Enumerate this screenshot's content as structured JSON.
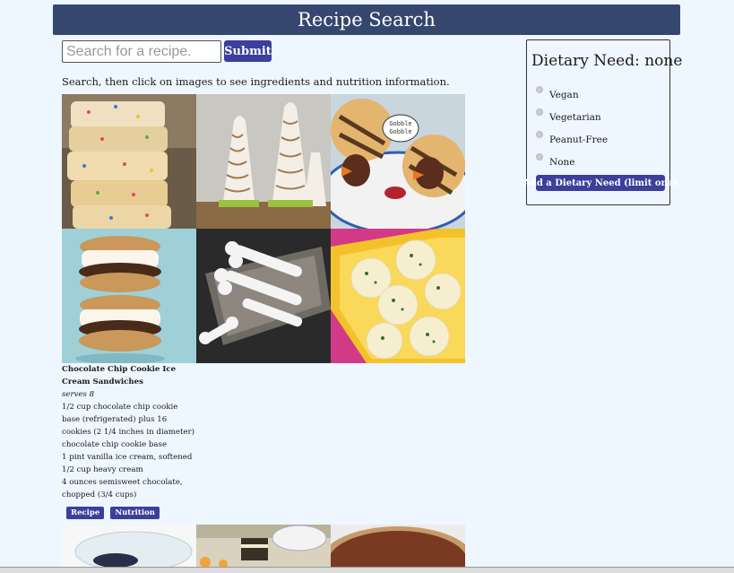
{
  "header": {
    "title": "Recipe Search"
  },
  "search": {
    "placeholder": "Search for a recipe.",
    "submit_label": "Submit"
  },
  "instructions": "Search, then click on images to see ingredients and nutrition information.",
  "recipe_detail": {
    "title": "Chocolate Chip Cookie Ice Cream Sandwiches",
    "serves": "serves 8",
    "ingredients": [
      "1/2 cup chocolate chip cookie base (refrigerated) plus 16 cookies (2 1/4 inches in diameter) chocolate chip cookie base",
      "1 pint vanilla ice cream, softened",
      "1/2 cup heavy cream",
      "4 ounces semisweet chocolate, chopped (3/4 cups)"
    ],
    "recipe_button": "Recipe",
    "nutrition_button": "Nutrition"
  },
  "speech_bubble": "Gobble Gobble",
  "dietary": {
    "title": "Dietary Need: none",
    "options": [
      "Vegan",
      "Vegetarian",
      "Peanut-Free",
      "None"
    ],
    "add_button": "Add a Dietary Need (limit one)"
  }
}
